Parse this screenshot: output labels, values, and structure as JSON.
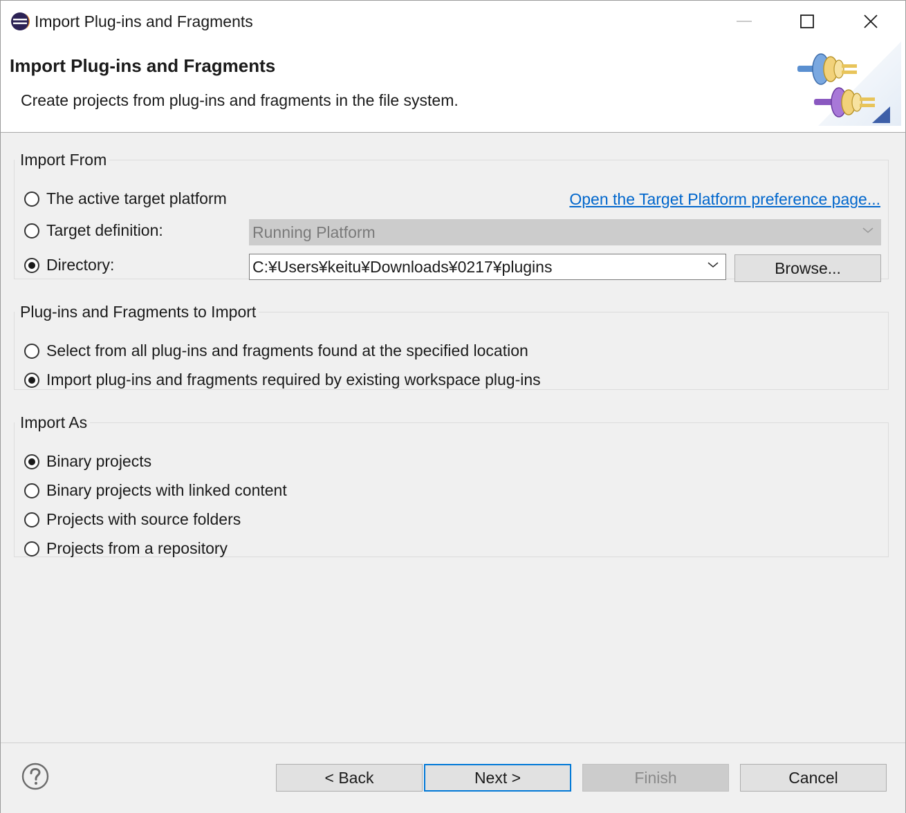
{
  "window": {
    "title": "Import Plug-ins and Fragments",
    "icon": "eclipse-icon"
  },
  "header": {
    "title": "Import Plug-ins and Fragments",
    "description": "Create projects from plug-ins and fragments in the file system.",
    "graphic": "plugin-connectors-wizard-graphic"
  },
  "import_from": {
    "legend": "Import From",
    "options": [
      {
        "label": "The active target platform",
        "checked": false
      },
      {
        "label": "Target definition:",
        "checked": false
      },
      {
        "label": "Directory:",
        "checked": true
      }
    ],
    "link": "Open the Target Platform preference page...",
    "target_definition_value": "Running Platform",
    "directory_value": "C:¥Users¥keitu¥Downloads¥0217¥plugins",
    "browse_label": "Browse..."
  },
  "to_import": {
    "legend": "Plug-ins and Fragments to Import",
    "options": [
      {
        "label": "Select from all plug-ins and fragments found at the specified location",
        "checked": false
      },
      {
        "label": "Import plug-ins and fragments required by existing workspace plug-ins",
        "checked": true
      }
    ]
  },
  "import_as": {
    "legend": "Import As",
    "options": [
      {
        "label": "Binary projects",
        "checked": true
      },
      {
        "label": "Binary projects with linked content",
        "checked": false
      },
      {
        "label": "Projects with source folders",
        "checked": false
      },
      {
        "label": "Projects from a repository",
        "checked": false
      }
    ]
  },
  "buttons": {
    "back": "< Back",
    "next": "Next >",
    "finish": "Finish",
    "cancel": "Cancel"
  },
  "colors": {
    "link": "#0066cc",
    "default_button_border": "#0078d7"
  }
}
